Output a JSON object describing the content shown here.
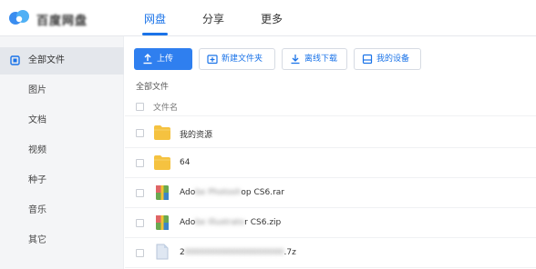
{
  "app": {
    "brand": "百度网盘"
  },
  "nav": {
    "tabs": [
      {
        "label": "网盘",
        "active": true
      },
      {
        "label": "分享",
        "active": false
      },
      {
        "label": "更多",
        "active": false
      }
    ]
  },
  "sidebar": {
    "items": [
      {
        "label": "全部文件",
        "active": true,
        "icon": "all-files-icon"
      },
      {
        "label": "图片",
        "active": false
      },
      {
        "label": "文档",
        "active": false
      },
      {
        "label": "视频",
        "active": false
      },
      {
        "label": "种子",
        "active": false
      },
      {
        "label": "音乐",
        "active": false
      },
      {
        "label": "其它",
        "active": false
      }
    ]
  },
  "toolbar": {
    "upload_label": "上传",
    "new_folder_label": "新建文件夹",
    "offline_download_label": "离线下载",
    "my_devices_label": "我的设备"
  },
  "breadcrumb": "全部文件",
  "file_list": {
    "column_name": "文件名",
    "files": [
      {
        "name": "我的资源",
        "type": "folder"
      },
      {
        "name": "64",
        "type": "folder"
      },
      {
        "prefix": "Ado",
        "masked": "be Photosh",
        "suffix": "op CS6.rar",
        "type": "rar"
      },
      {
        "prefix": "Ado",
        "masked": "be Illustrato",
        "suffix": "r CS6.zip",
        "type": "zip"
      },
      {
        "prefix": "2",
        "masked": "0000000000000000000",
        "suffix": ".7z",
        "type": "7z"
      }
    ]
  },
  "colors": {
    "accent": "#1a73e8",
    "primary_button": "#2f7fef",
    "folder": "#f5c240",
    "sidebar_bg": "#f4f5f7"
  }
}
